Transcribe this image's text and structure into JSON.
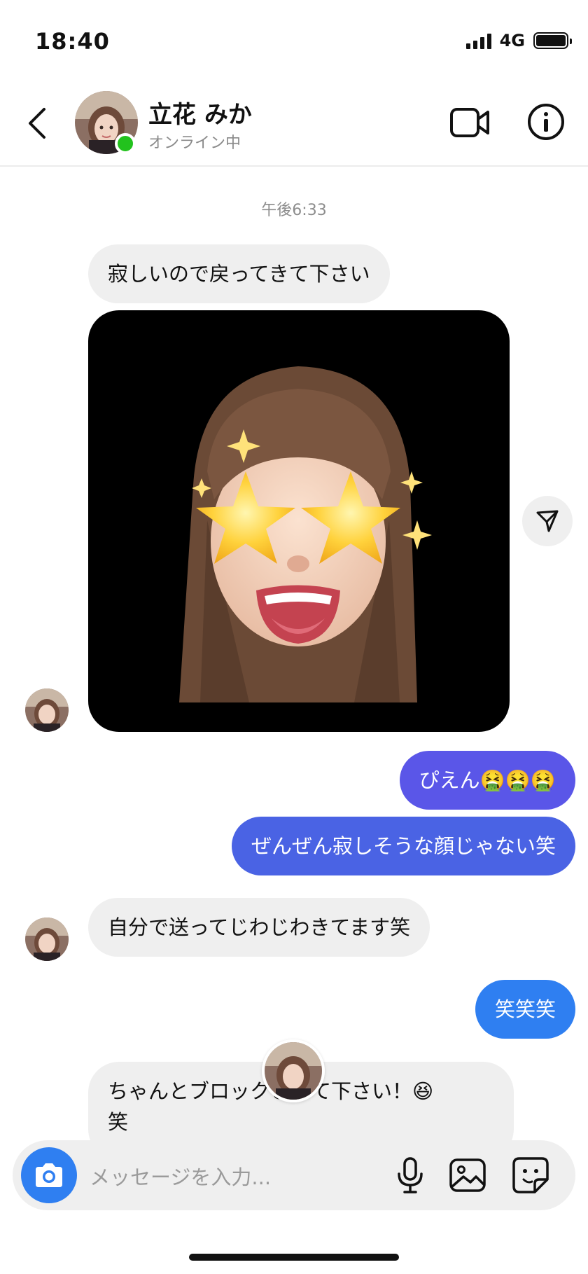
{
  "status_bar": {
    "time": "18:40",
    "network": "4G"
  },
  "header": {
    "contact_name": "立花 みか",
    "contact_status": "オンライン中"
  },
  "chat": {
    "timestamp": "午後6:33",
    "messages": [
      {
        "from": "them",
        "text": "寂しいので戻ってきて下さい"
      },
      {
        "from": "them",
        "type": "memoji"
      },
      {
        "from": "me",
        "text": "ぴえん🤮🤮🤮"
      },
      {
        "from": "me",
        "text": "ぜんぜん寂しそうな顔じゃない笑"
      },
      {
        "from": "them",
        "text": "自分で送ってじわじわきてます笑"
      },
      {
        "from": "me",
        "text": "笑笑笑"
      },
      {
        "from": "them",
        "text": "ちゃんとブロックさせて下さい！😆",
        "text_line2": "笑"
      }
    ]
  },
  "input": {
    "placeholder": "メッセージを入力..."
  },
  "colors": {
    "accent_blue": "#2f7ff1",
    "outgoing_purple": "#5a56e8",
    "outgoing_indigo": "#4a63e4",
    "online_green": "#22c21d",
    "incoming_bg": "#efefef"
  }
}
